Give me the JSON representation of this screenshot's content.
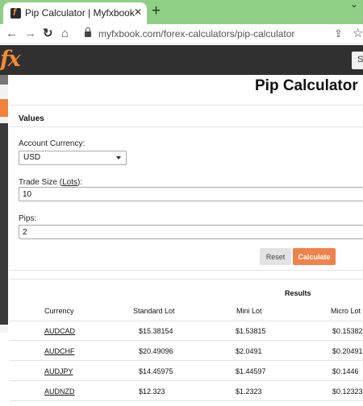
{
  "browser": {
    "tab_title": "Pip Calculator | Myfxbook",
    "tab_close_glyph": "✕",
    "new_tab_glyph": "+",
    "caret_glyph": "⌄",
    "url": "myfxbook.com/forex-calculators/pip-calculator",
    "icons": [
      "back-arrow-icon",
      "forward-arrow-icon",
      "reload-icon",
      "home-icon",
      "lock-icon",
      "share-icon",
      "star-icon"
    ]
  },
  "site": {
    "logo_text": "fx",
    "header_button_label": "S",
    "accent_color": "#f0824a",
    "header_color": "#303030"
  },
  "calculator": {
    "title": "Pip Calculator",
    "section_heading": "Values",
    "account_currency_label": "Account Currency:",
    "account_currency_value": "USD",
    "trade_size_label_prefix": "Trade Size (",
    "trade_size_label_link": "Lots",
    "trade_size_label_suffix": "):",
    "trade_size_value": "10",
    "pips_label": "Pips:",
    "pips_value": "2",
    "reset_label": "Reset",
    "calculate_label": "Calculate"
  },
  "results": {
    "heading": "Results",
    "columns": [
      "Currency",
      "Standard Lot",
      "Mini Lot",
      "Micro Lot"
    ],
    "rows": [
      {
        "pair": "AUDCAD",
        "standard": "$15.38154",
        "mini": "$1.53815",
        "micro": "$0.15382"
      },
      {
        "pair": "AUDCHF",
        "standard": "$20.49096",
        "mini": "$2.0491",
        "micro": "$0.20491"
      },
      {
        "pair": "AUDJPY",
        "standard": "$14.45975",
        "mini": "$1.44597",
        "micro": "$0.1446"
      },
      {
        "pair": "AUDNZD",
        "standard": "$12.323",
        "mini": "$1.2323",
        "micro": "$0.12323"
      }
    ]
  }
}
